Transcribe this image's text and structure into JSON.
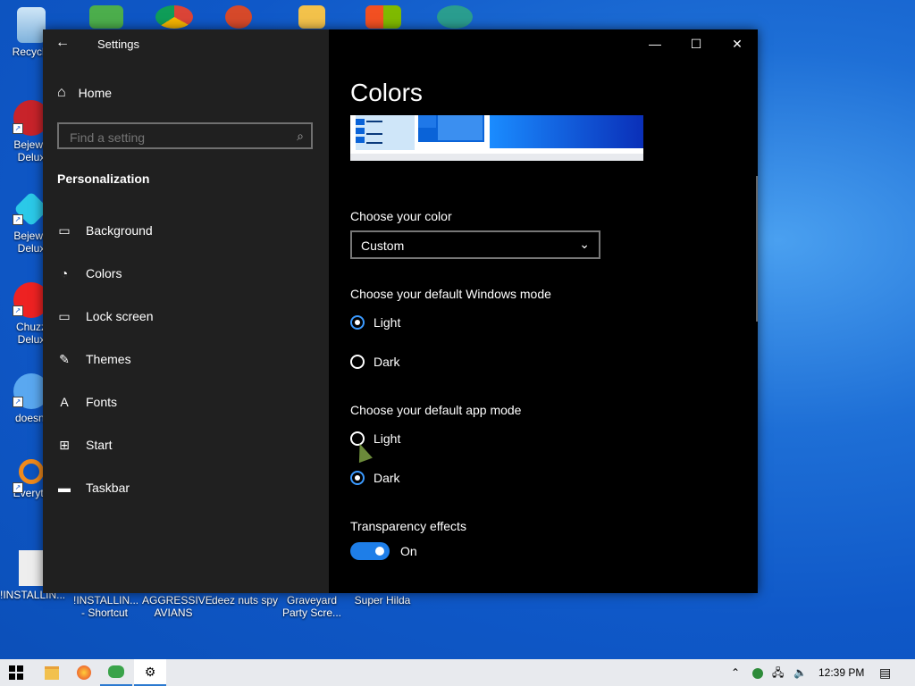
{
  "desktop_icons": [
    {
      "label": "Recycle",
      "color": "#9fc9e8"
    },
    {
      "label": "Bejewe\nDelux",
      "color": "#d33"
    },
    {
      "label": "Bejewe\nDelux",
      "color": "#2bc9e8"
    },
    {
      "label": "Chuzz\nDelux",
      "color": "#e22"
    },
    {
      "label": "doesnt",
      "color": "#5aa8f0"
    },
    {
      "label": "Everyth",
      "color": "#f08a1c"
    },
    {
      "label": "!INSTALLIN...",
      "color": "#ddd"
    },
    {
      "label": "!INSTALLIN...\n- Shortcut",
      "color": ""
    },
    {
      "label": "AGGRESSIVE\nAVIANS",
      "color": ""
    },
    {
      "label": "deez nuts spy",
      "color": ""
    },
    {
      "label": "Graveyard\nParty Scre...",
      "color": ""
    },
    {
      "label": "Super Hilda",
      "color": ""
    }
  ],
  "window": {
    "title": "Settings",
    "back_icon": "arrow-left-icon",
    "controls": {
      "minimize": "—",
      "maximize": "☐",
      "close": "✕"
    }
  },
  "sidebar": {
    "home_label": "Home",
    "search_placeholder": "Find a setting",
    "section_title": "Personalization",
    "items": [
      {
        "label": "Background",
        "icon": "image-icon"
      },
      {
        "label": "Colors",
        "icon": "palette-icon"
      },
      {
        "label": "Lock screen",
        "icon": "lock-screen-icon"
      },
      {
        "label": "Themes",
        "icon": "brush-icon"
      },
      {
        "label": "Fonts",
        "icon": "font-icon"
      },
      {
        "label": "Start",
        "icon": "start-icon"
      },
      {
        "label": "Taskbar",
        "icon": "taskbar-icon"
      }
    ]
  },
  "content": {
    "title": "Colors",
    "choose_color_label": "Choose your color",
    "choose_color_value": "Custom",
    "windows_mode_label": "Choose your default Windows mode",
    "windows_mode": {
      "light": "Light",
      "dark": "Dark",
      "selected": "Light"
    },
    "app_mode_label": "Choose your default app mode",
    "app_mode": {
      "light": "Light",
      "dark": "Dark",
      "selected": "Dark"
    },
    "transparency_label": "Transparency effects",
    "transparency_value": "On"
  },
  "taskbar": {
    "clock": "12:39 PM"
  }
}
